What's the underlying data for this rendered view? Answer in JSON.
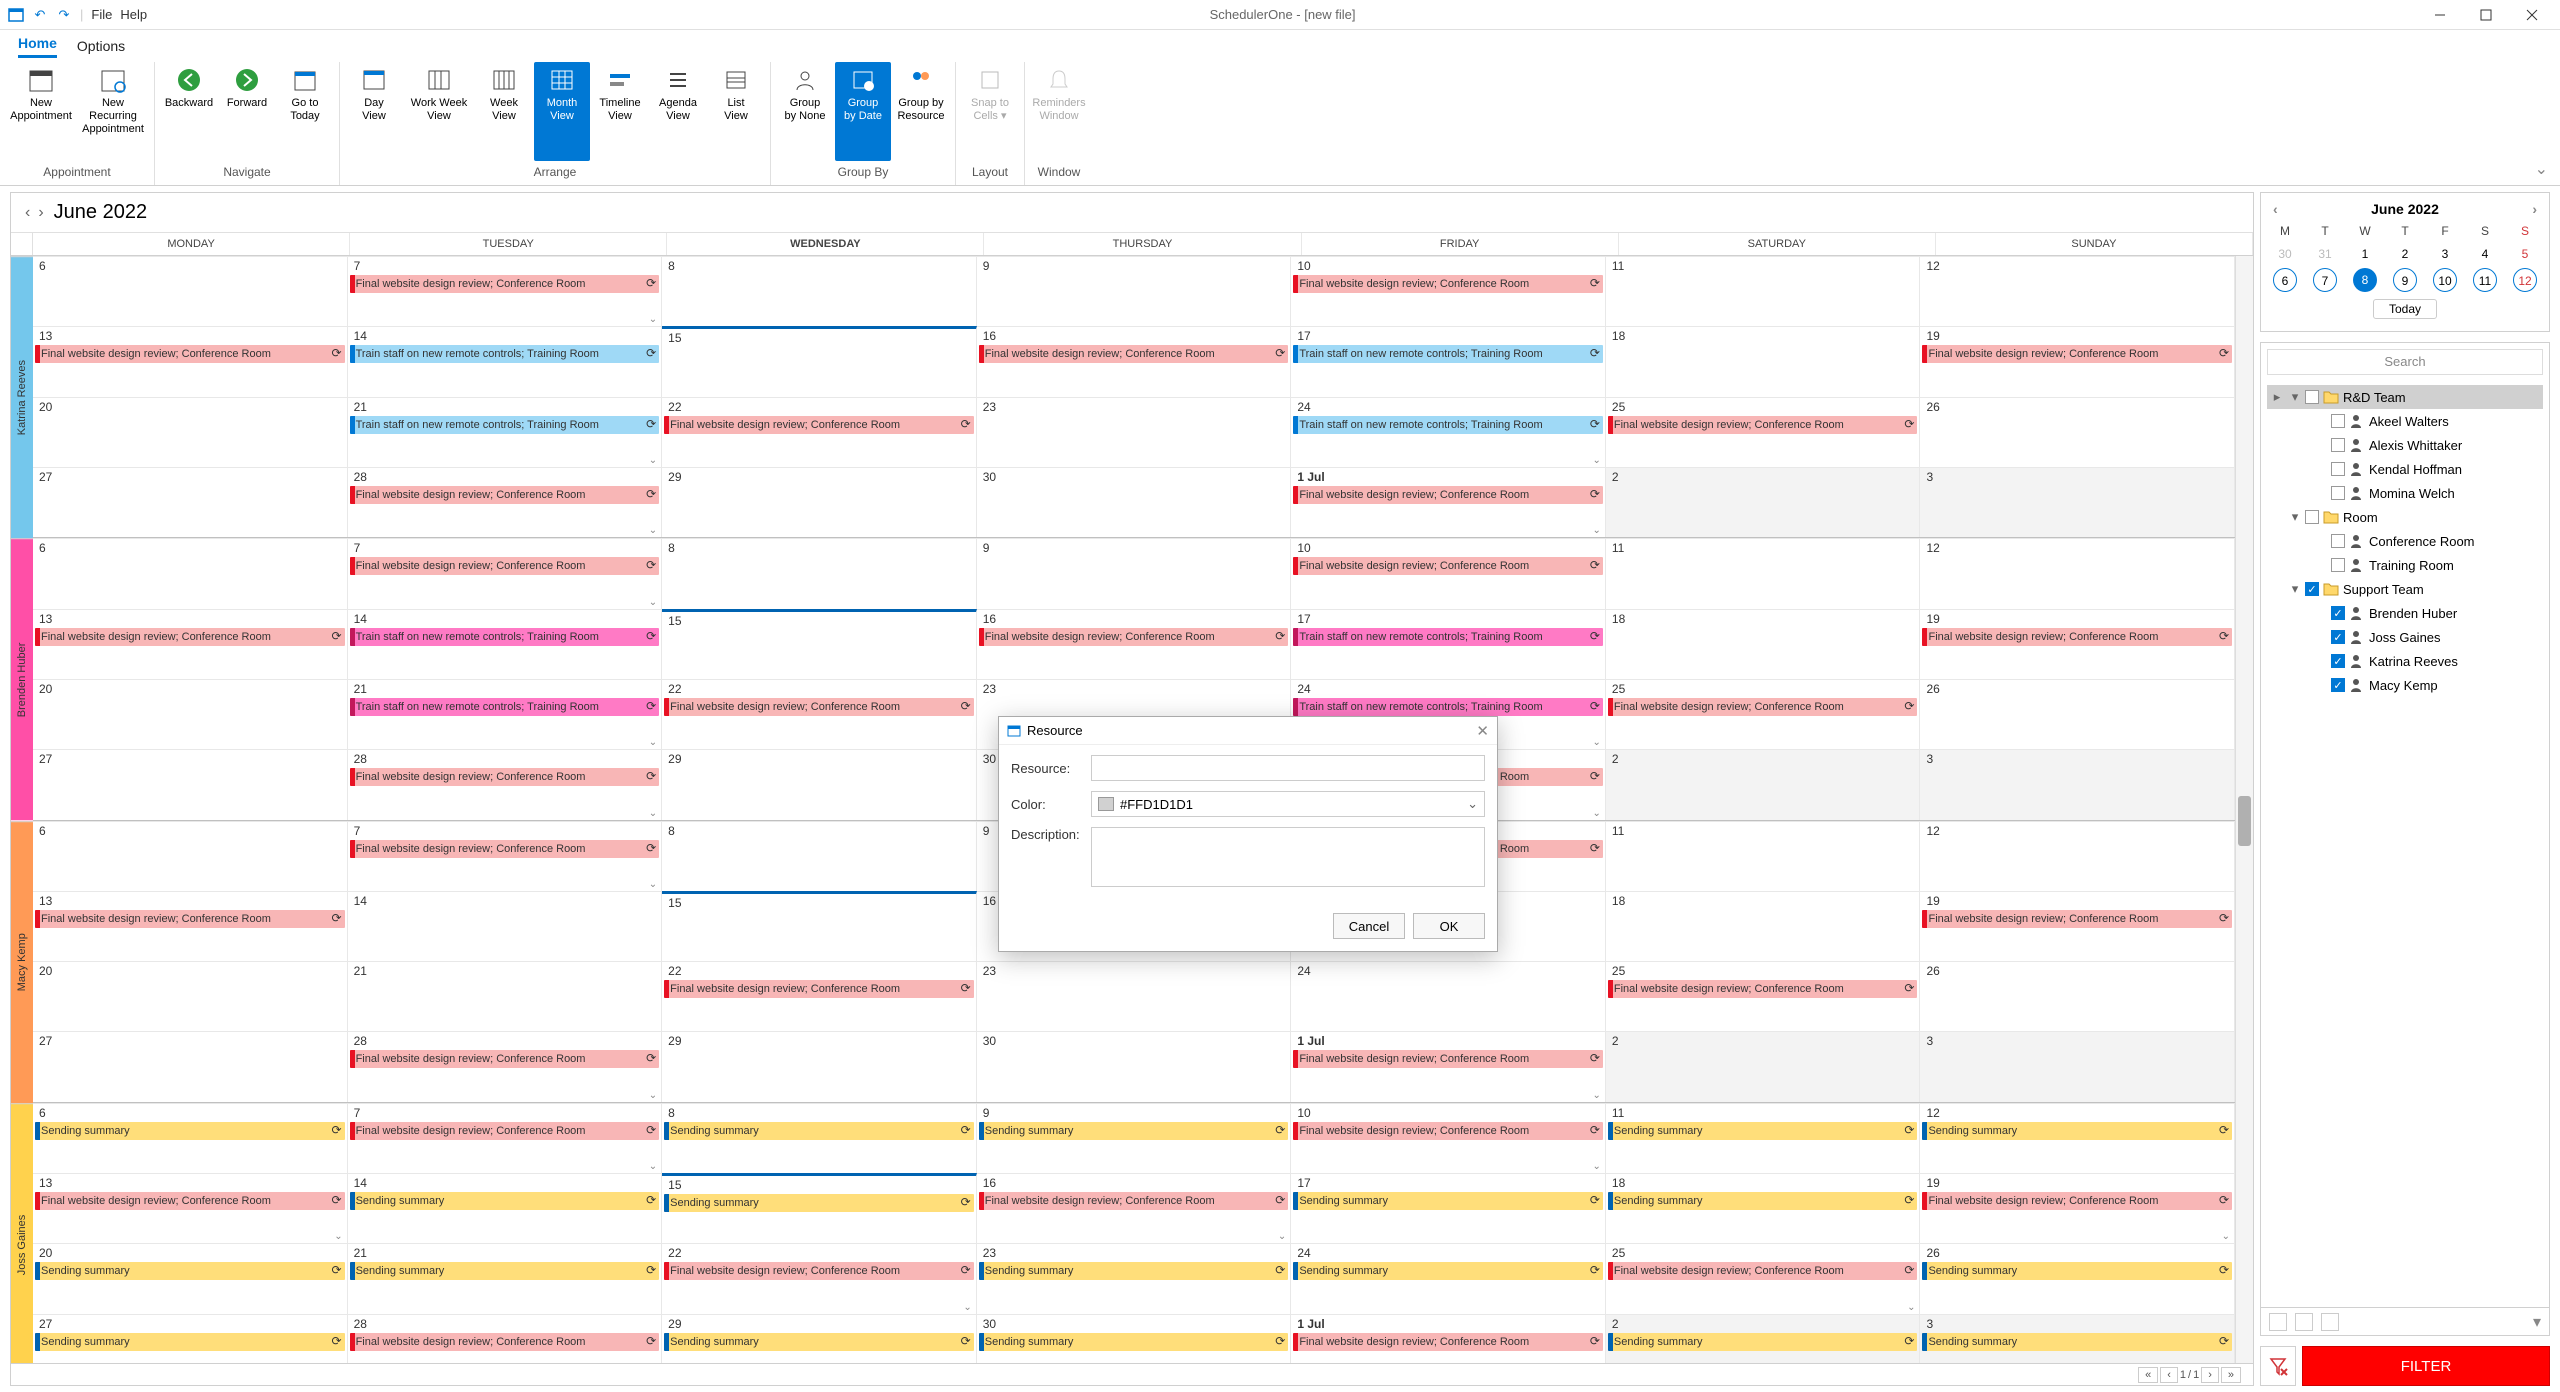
{
  "app": {
    "title": "SchedulerOne - [new file]"
  },
  "menu": {
    "file": "File",
    "help": "Help"
  },
  "tabs": {
    "home": "Home",
    "options": "Options"
  },
  "ribbon": {
    "groups": {
      "appointment": "Appointment",
      "navigate": "Navigate",
      "arrange": "Arrange",
      "groupby": "Group By",
      "layout": "Layout",
      "window": "Window"
    },
    "items": {
      "new_appt": "New\nAppointment",
      "new_rec": "New Recurring\nAppointment",
      "backward": "Backward",
      "forward": "Forward",
      "goto_today": "Go to\nToday",
      "day_view": "Day\nView",
      "workweek": "Work Week\nView",
      "week": "Week\nView",
      "month": "Month\nView",
      "timeline": "Timeline\nView",
      "agenda": "Agenda\nView",
      "list": "List\nView",
      "group_none": "Group\nby None",
      "group_date": "Group\nby Date",
      "group_res": "Group by\nResource",
      "snap": "Snap to\nCells ▾",
      "reminders": "Reminders\nWindow"
    }
  },
  "calendar": {
    "title": "June 2022",
    "days": [
      "MONDAY",
      "TUESDAY",
      "WEDNESDAY",
      "THURSDAY",
      "FRIDAY",
      "SATURDAY",
      "SUNDAY"
    ],
    "resources": [
      {
        "name": "Katrina Reeves",
        "class": "strip-blue",
        "alt": "blue"
      },
      {
        "name": "Brenden Huber",
        "class": "strip-pink",
        "alt": "mag"
      },
      {
        "name": "Macy Kemp",
        "class": "strip-orange",
        "alt": "orange"
      },
      {
        "name": "Joss Gaines",
        "class": "strip-yellow",
        "alt": "yel"
      }
    ],
    "events_text": {
      "design": "Final website design review; Conference Room",
      "train": "Train staff on new remote controls; Training Room",
      "sending": "Sending summary"
    },
    "status": {
      "page": "1",
      "of": "1"
    }
  },
  "mini": {
    "month": "June 2022",
    "dow": [
      "M",
      "T",
      "W",
      "T",
      "F",
      "S",
      "S"
    ],
    "prev": [
      "30",
      "31"
    ],
    "days": [
      "1",
      "2",
      "3",
      "4",
      "5",
      "6",
      "7",
      "8",
      "9",
      "10",
      "11",
      "12"
    ],
    "today_label": "Today"
  },
  "tree": {
    "search": "Search",
    "groups": {
      "rnd": "R&D Team",
      "room": "Room",
      "support": "Support Team"
    },
    "rnd_members": [
      "Akeel Walters",
      "Alexis Whittaker",
      "Kendal Hoffman",
      "Momina Welch"
    ],
    "rooms": [
      "Conference Room",
      "Training Room"
    ],
    "support_members": [
      "Brenden Huber",
      "Joss Gaines",
      "Katrina Reeves",
      "Macy Kemp"
    ]
  },
  "filter": {
    "label": "FILTER"
  },
  "dialog": {
    "title": "Resource",
    "resource_label": "Resource:",
    "color_label": "Color:",
    "color_value": "#FFD1D1D1",
    "desc_label": "Description:",
    "cancel": "Cancel",
    "ok": "OK"
  }
}
